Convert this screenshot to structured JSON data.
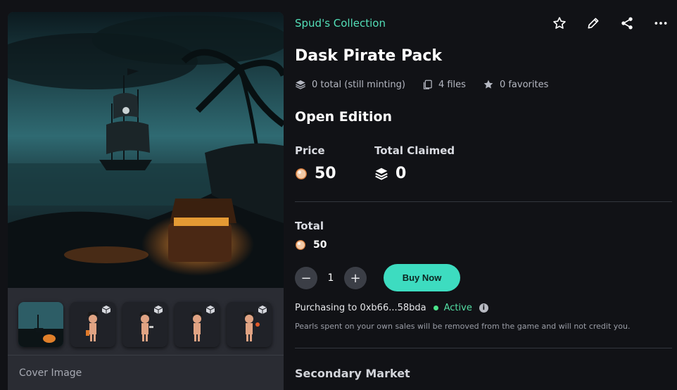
{
  "collection_name": "Spud's Collection",
  "title": "Dask Pirate Pack",
  "stats": {
    "total": "0 total (still minting)",
    "files": "4 files",
    "favorites": "0 favorites"
  },
  "edition": "Open Edition",
  "price": {
    "label": "Price",
    "value": "50",
    "currency_icon": "pearl-icon"
  },
  "claimed": {
    "label": "Total Claimed",
    "value": "0",
    "icon": "layers-icon"
  },
  "total": {
    "label": "Total",
    "value": "50"
  },
  "quantity": {
    "value": "1",
    "minus": "−",
    "plus": "+"
  },
  "buy_label": "Buy Now",
  "purchasing": {
    "text": "Purchasing to 0xb66...58bda",
    "status": "Active"
  },
  "note": "Pearls spent on your own sales will be removed from the game and will not credit you.",
  "secondary_market": "Secondary Market",
  "media": {
    "caption": "Cover Image",
    "thumbnails": [
      "cover",
      "pirate-1",
      "pirate-2",
      "pirate-3",
      "pirate-4"
    ]
  },
  "colors": {
    "accent": "#53dfb8",
    "button": "#3ddcc0",
    "active": "#4be38a",
    "background": "#111216"
  },
  "icons": [
    "star-outline-icon",
    "pencil-icon",
    "share-icon",
    "more-icon",
    "stack-icon",
    "files-icon",
    "star-icon",
    "cube-icon",
    "info-icon"
  ]
}
